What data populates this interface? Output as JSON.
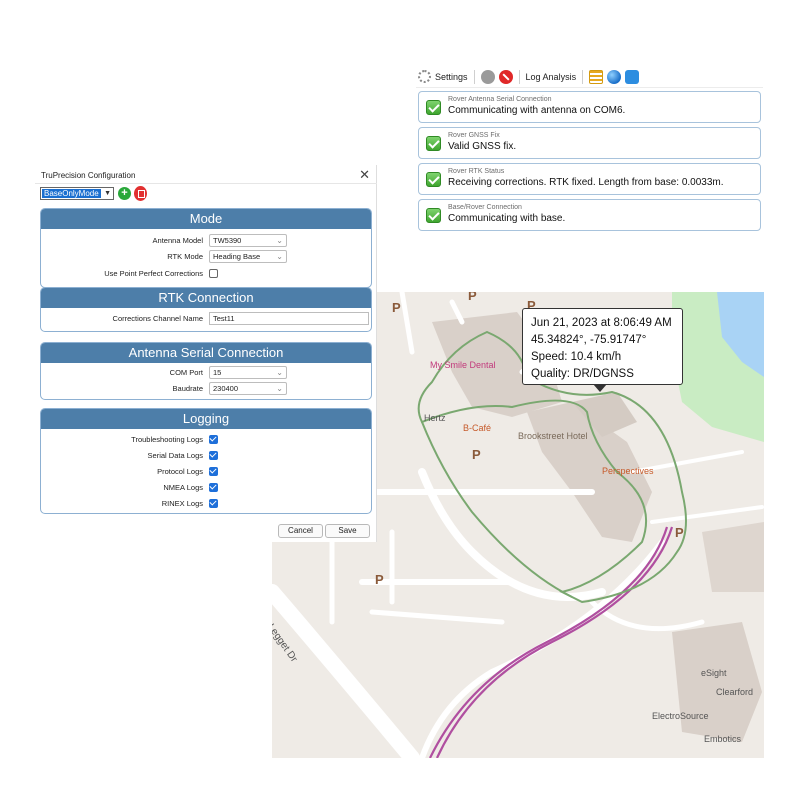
{
  "status_panel": {
    "toolbar": {
      "settings_label": "Settings",
      "log_analysis_label": "Log Analysis"
    },
    "cards": [
      {
        "title": "Rover Antenna Serial Connection",
        "text": "Communicating with antenna on COM6."
      },
      {
        "title": "Rover GNSS Fix",
        "text": "Valid GNSS fix."
      },
      {
        "title": "Rover RTK Status",
        "text": "Receiving corrections. RTK fixed. Length from base: 0.0033m."
      },
      {
        "title": "Base/Rover Connection",
        "text": "Communicating with base."
      }
    ]
  },
  "config": {
    "title": "TruPrecision Configuration",
    "close": "✕",
    "mode_value": "BaseOnlyMode",
    "add_symbol": "+",
    "sections": {
      "mode": {
        "heading": "Mode",
        "antenna_model_label": "Antenna Model",
        "antenna_model_value": "TW5390",
        "rtk_mode_label": "RTK Mode",
        "rtk_mode_value": "Heading Base",
        "ppp_label": "Use Point Perfect Corrections"
      },
      "rtk": {
        "heading": "RTK Connection",
        "channel_label": "Corrections Channel Name",
        "channel_value": "Test11"
      },
      "serial": {
        "heading": "Antenna Serial Connection",
        "com_label": "COM Port",
        "com_value": "15",
        "baud_label": "Baudrate",
        "baud_value": "230400"
      },
      "logging": {
        "heading": "Logging",
        "items": [
          {
            "label": "Troubleshooting Logs",
            "checked": true
          },
          {
            "label": "Serial Data Logs",
            "checked": true
          },
          {
            "label": "Protocol Logs",
            "checked": true
          },
          {
            "label": "NMEA Logs",
            "checked": true
          },
          {
            "label": "RINEX Logs",
            "checked": true
          }
        ]
      }
    },
    "cancel_label": "Cancel",
    "save_label": "Save"
  },
  "map": {
    "tooltip": {
      "datetime": "Jun 21, 2023 at 8:06:49 AM",
      "coords": "45.34824°, -75.91747°",
      "speed": "Speed: 10.4 km/h",
      "quality": "Quality: DR/DGNSS"
    },
    "labels": {
      "my_smile": "My Smile Dental",
      "hertz": "Hertz",
      "bcafe": "B-Café",
      "brookstreet": "Brookstreet Hotel",
      "perspectives": "Perspectives",
      "esight": "eSight",
      "clearford": "Clearford",
      "electrosource": "ElectroSource",
      "embotics": "Embotics",
      "street": "Legget Dr",
      "parking": "P"
    }
  }
}
